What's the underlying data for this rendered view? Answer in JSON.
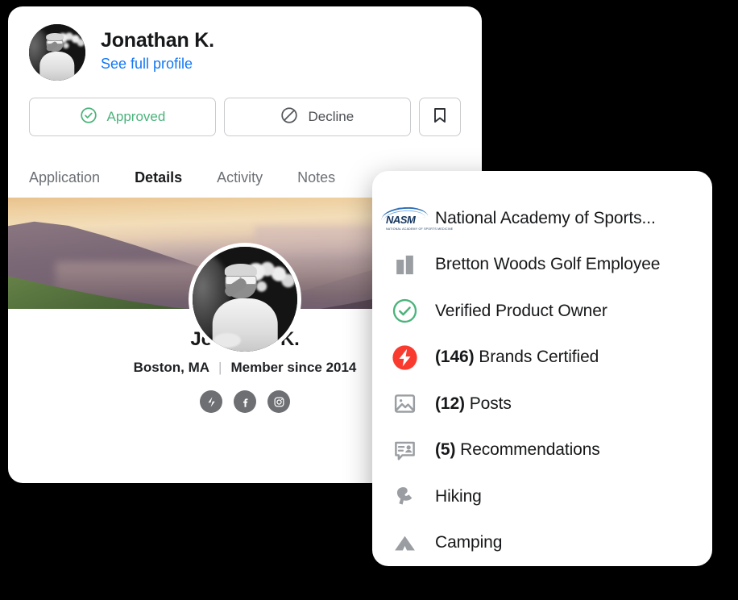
{
  "profile_card": {
    "header": {
      "name": "Jonathan K.",
      "link_label": "See full profile",
      "avatar_alt": "jonathan-k-avatar"
    },
    "actions": {
      "approved_label": "Approved",
      "approved_color": "#4CB37C",
      "decline_label": "Decline",
      "decline_color": "#4c4f53",
      "bookmark_icon": "bookmark-icon"
    },
    "tabs": [
      {
        "label": "Application",
        "active": false
      },
      {
        "label": "Details",
        "active": true
      },
      {
        "label": "Activity",
        "active": false
      },
      {
        "label": "Notes",
        "active": false
      }
    ],
    "active_tab_underline_color": "#FB3B30",
    "hero": {
      "alt": "mountain-valley-sunset-banner"
    },
    "identity": {
      "name": "Jonathan K.",
      "location": "Boston, MA",
      "divider": "|",
      "membership": "Member since 2014"
    },
    "socials": [
      {
        "icon": "strava-bolt-icon",
        "name": "strava"
      },
      {
        "icon": "facebook-icon",
        "name": "facebook"
      },
      {
        "icon": "instagram-icon",
        "name": "instagram"
      }
    ]
  },
  "details_panel": {
    "rows": [
      {
        "icon": "nasm-logo-icon",
        "count": "",
        "label": "National Academy of Sports...",
        "icon_color": "#16365e"
      },
      {
        "icon": "building-icon",
        "count": "",
        "label": "Bretton Woods Golf Employee",
        "icon_color": "#9a9da1"
      },
      {
        "icon": "verified-check-icon",
        "count": "",
        "label": "Verified Product Owner",
        "icon_color": "#4CB37C"
      },
      {
        "icon": "red-bolt-badge-icon",
        "count": "(146)",
        "label": "Brands Certified",
        "icon_color": "#F93A2F"
      },
      {
        "icon": "image-icon",
        "count": "(12)",
        "label": "Posts",
        "icon_color": "#9a9da1"
      },
      {
        "icon": "recommendation-bubble-icon",
        "count": "(5)",
        "label": "Recommendations",
        "icon_color": "#9a9da1"
      },
      {
        "icon": "hiking-icon",
        "count": "",
        "label": "Hiking",
        "icon_color": "#9a9da1"
      },
      {
        "icon": "camping-tent-icon",
        "count": "",
        "label": "Camping",
        "icon_color": "#9a9da1"
      }
    ]
  },
  "nasm_logo": {
    "wordmark": "NASM",
    "tagline": "NATIONAL ACADEMY OF SPORTS MEDICINE"
  }
}
